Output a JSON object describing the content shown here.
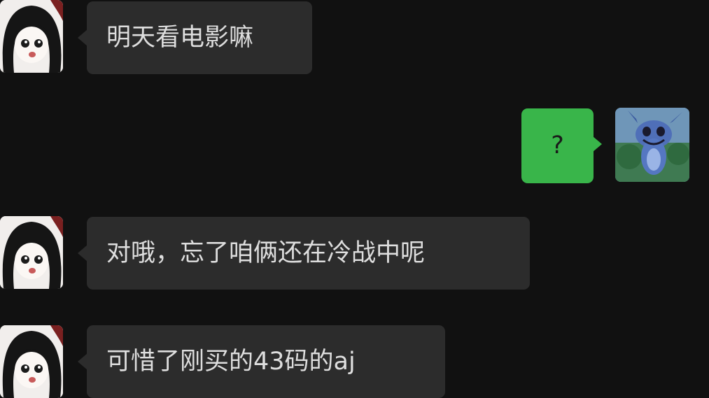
{
  "messages": [
    {
      "side": "left",
      "text": "明天看电影嘛"
    },
    {
      "side": "right",
      "text": "?"
    },
    {
      "side": "left",
      "text": "对哦，忘了咱俩还在冷战中呢"
    },
    {
      "side": "left",
      "text": "可惜了刚买的43码的aj"
    }
  ],
  "colors": {
    "background": "#111111",
    "incoming_bubble": "#2c2c2c",
    "outgoing_bubble": "#39b54a"
  },
  "avatars": {
    "contact": "anime-girl-avatar",
    "self": "stitch-cartoon-avatar"
  }
}
